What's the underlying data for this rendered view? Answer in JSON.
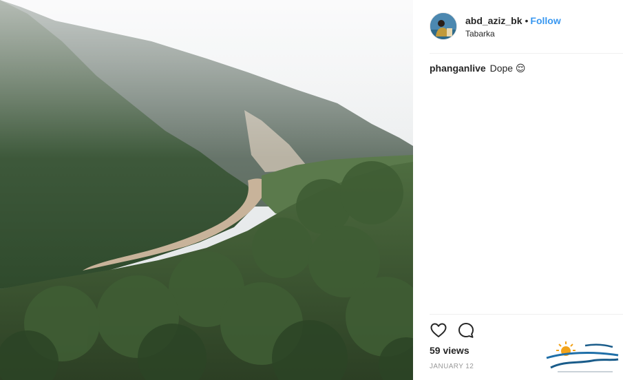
{
  "post": {
    "username": "abd_aziz_bk",
    "separator": "•",
    "follow_label": "Follow",
    "location": "Tabarka"
  },
  "comment": {
    "username": "phanganlive",
    "text": "Dope 😌"
  },
  "actions": {
    "like_icon": "heart-icon",
    "comment_icon": "comment-icon"
  },
  "stats": {
    "views": "59 views",
    "date": "JANUARY 12"
  },
  "colors": {
    "link": "#3897f0",
    "text": "#262626",
    "muted": "#999999",
    "divider": "#efefef"
  }
}
